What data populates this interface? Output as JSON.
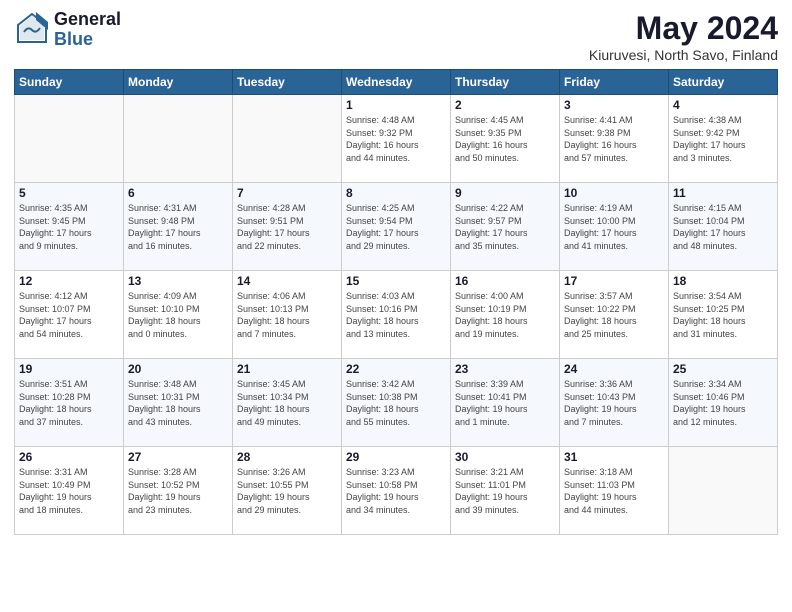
{
  "header": {
    "logo_general": "General",
    "logo_blue": "Blue",
    "title": "May 2024",
    "subtitle": "Kiuruvesi, North Savo, Finland"
  },
  "columns": [
    "Sunday",
    "Monday",
    "Tuesday",
    "Wednesday",
    "Thursday",
    "Friday",
    "Saturday"
  ],
  "weeks": [
    {
      "days": [
        {
          "number": "",
          "info": ""
        },
        {
          "number": "",
          "info": ""
        },
        {
          "number": "",
          "info": ""
        },
        {
          "number": "1",
          "info": "Sunrise: 4:48 AM\nSunset: 9:32 PM\nDaylight: 16 hours\nand 44 minutes."
        },
        {
          "number": "2",
          "info": "Sunrise: 4:45 AM\nSunset: 9:35 PM\nDaylight: 16 hours\nand 50 minutes."
        },
        {
          "number": "3",
          "info": "Sunrise: 4:41 AM\nSunset: 9:38 PM\nDaylight: 16 hours\nand 57 minutes."
        },
        {
          "number": "4",
          "info": "Sunrise: 4:38 AM\nSunset: 9:42 PM\nDaylight: 17 hours\nand 3 minutes."
        }
      ]
    },
    {
      "days": [
        {
          "number": "5",
          "info": "Sunrise: 4:35 AM\nSunset: 9:45 PM\nDaylight: 17 hours\nand 9 minutes."
        },
        {
          "number": "6",
          "info": "Sunrise: 4:31 AM\nSunset: 9:48 PM\nDaylight: 17 hours\nand 16 minutes."
        },
        {
          "number": "7",
          "info": "Sunrise: 4:28 AM\nSunset: 9:51 PM\nDaylight: 17 hours\nand 22 minutes."
        },
        {
          "number": "8",
          "info": "Sunrise: 4:25 AM\nSunset: 9:54 PM\nDaylight: 17 hours\nand 29 minutes."
        },
        {
          "number": "9",
          "info": "Sunrise: 4:22 AM\nSunset: 9:57 PM\nDaylight: 17 hours\nand 35 minutes."
        },
        {
          "number": "10",
          "info": "Sunrise: 4:19 AM\nSunset: 10:00 PM\nDaylight: 17 hours\nand 41 minutes."
        },
        {
          "number": "11",
          "info": "Sunrise: 4:15 AM\nSunset: 10:04 PM\nDaylight: 17 hours\nand 48 minutes."
        }
      ]
    },
    {
      "days": [
        {
          "number": "12",
          "info": "Sunrise: 4:12 AM\nSunset: 10:07 PM\nDaylight: 17 hours\nand 54 minutes."
        },
        {
          "number": "13",
          "info": "Sunrise: 4:09 AM\nSunset: 10:10 PM\nDaylight: 18 hours\nand 0 minutes."
        },
        {
          "number": "14",
          "info": "Sunrise: 4:06 AM\nSunset: 10:13 PM\nDaylight: 18 hours\nand 7 minutes."
        },
        {
          "number": "15",
          "info": "Sunrise: 4:03 AM\nSunset: 10:16 PM\nDaylight: 18 hours\nand 13 minutes."
        },
        {
          "number": "16",
          "info": "Sunrise: 4:00 AM\nSunset: 10:19 PM\nDaylight: 18 hours\nand 19 minutes."
        },
        {
          "number": "17",
          "info": "Sunrise: 3:57 AM\nSunset: 10:22 PM\nDaylight: 18 hours\nand 25 minutes."
        },
        {
          "number": "18",
          "info": "Sunrise: 3:54 AM\nSunset: 10:25 PM\nDaylight: 18 hours\nand 31 minutes."
        }
      ]
    },
    {
      "days": [
        {
          "number": "19",
          "info": "Sunrise: 3:51 AM\nSunset: 10:28 PM\nDaylight: 18 hours\nand 37 minutes."
        },
        {
          "number": "20",
          "info": "Sunrise: 3:48 AM\nSunset: 10:31 PM\nDaylight: 18 hours\nand 43 minutes."
        },
        {
          "number": "21",
          "info": "Sunrise: 3:45 AM\nSunset: 10:34 PM\nDaylight: 18 hours\nand 49 minutes."
        },
        {
          "number": "22",
          "info": "Sunrise: 3:42 AM\nSunset: 10:38 PM\nDaylight: 18 hours\nand 55 minutes."
        },
        {
          "number": "23",
          "info": "Sunrise: 3:39 AM\nSunset: 10:41 PM\nDaylight: 19 hours\nand 1 minute."
        },
        {
          "number": "24",
          "info": "Sunrise: 3:36 AM\nSunset: 10:43 PM\nDaylight: 19 hours\nand 7 minutes."
        },
        {
          "number": "25",
          "info": "Sunrise: 3:34 AM\nSunset: 10:46 PM\nDaylight: 19 hours\nand 12 minutes."
        }
      ]
    },
    {
      "days": [
        {
          "number": "26",
          "info": "Sunrise: 3:31 AM\nSunset: 10:49 PM\nDaylight: 19 hours\nand 18 minutes."
        },
        {
          "number": "27",
          "info": "Sunrise: 3:28 AM\nSunset: 10:52 PM\nDaylight: 19 hours\nand 23 minutes."
        },
        {
          "number": "28",
          "info": "Sunrise: 3:26 AM\nSunset: 10:55 PM\nDaylight: 19 hours\nand 29 minutes."
        },
        {
          "number": "29",
          "info": "Sunrise: 3:23 AM\nSunset: 10:58 PM\nDaylight: 19 hours\nand 34 minutes."
        },
        {
          "number": "30",
          "info": "Sunrise: 3:21 AM\nSunset: 11:01 PM\nDaylight: 19 hours\nand 39 minutes."
        },
        {
          "number": "31",
          "info": "Sunrise: 3:18 AM\nSunset: 11:03 PM\nDaylight: 19 hours\nand 44 minutes."
        },
        {
          "number": "",
          "info": ""
        }
      ]
    }
  ]
}
